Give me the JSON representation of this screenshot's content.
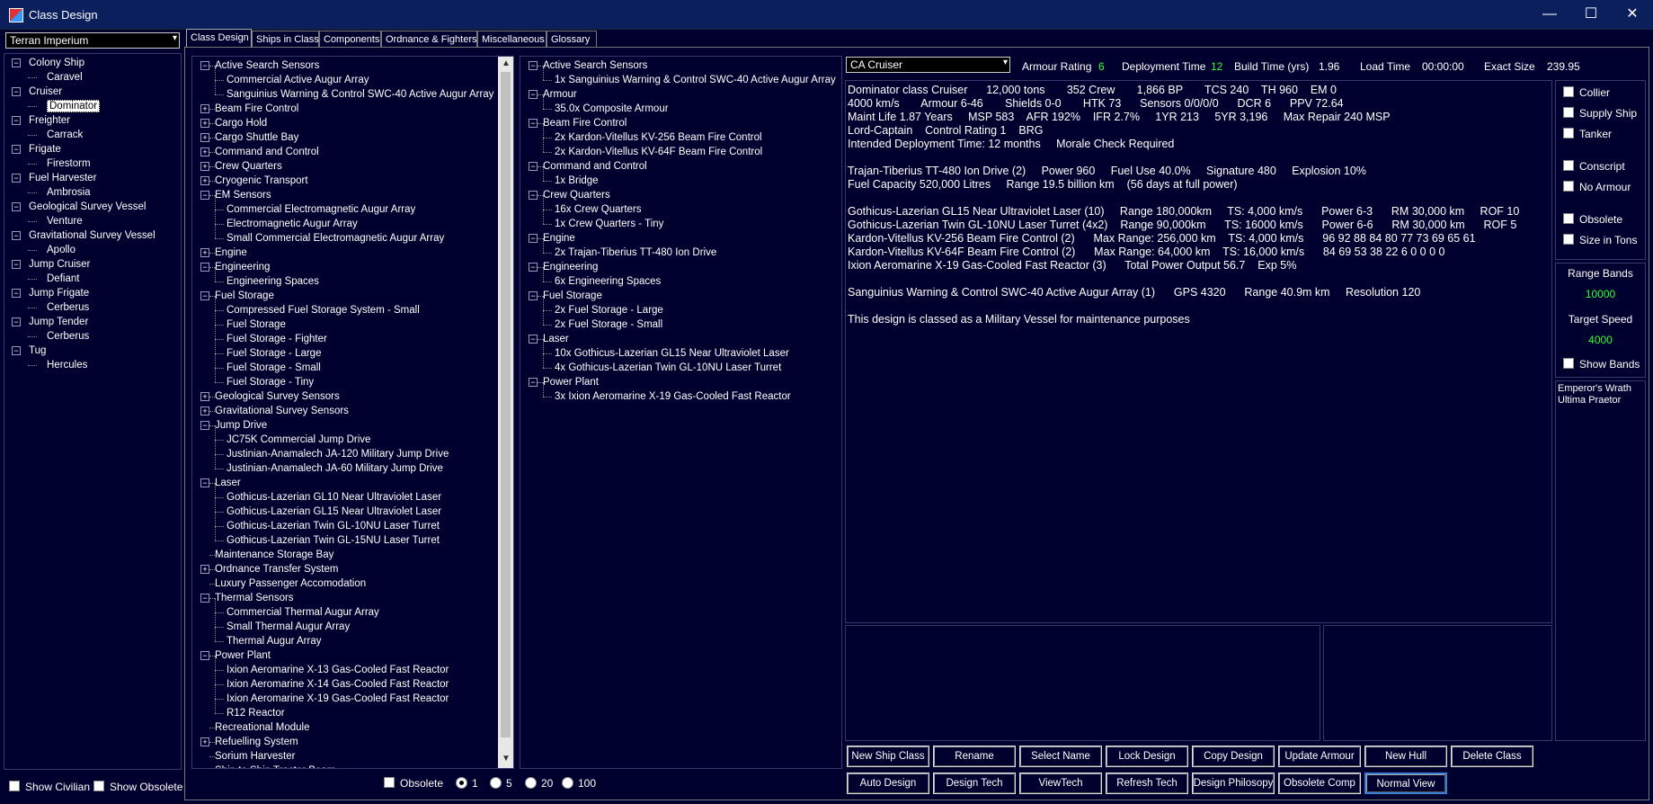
{
  "window": {
    "title": "Class Design",
    "min": "—",
    "max": "☐",
    "close": "✕"
  },
  "left": {
    "race": "Terran Imperium",
    "tree": [
      {
        "label": "Colony Ship",
        "children": [
          "Caravel"
        ]
      },
      {
        "label": "Cruiser",
        "children": [
          "Dominator"
        ]
      },
      {
        "label": "Freighter",
        "children": [
          "Carrack"
        ]
      },
      {
        "label": "Frigate",
        "children": [
          "Firestorm"
        ]
      },
      {
        "label": "Fuel Harvester",
        "children": [
          "Ambrosia"
        ]
      },
      {
        "label": "Geological Survey Vessel",
        "children": [
          "Venture"
        ]
      },
      {
        "label": "Gravitational Survey Vessel",
        "children": [
          "Apollo"
        ]
      },
      {
        "label": "Jump Cruiser",
        "children": [
          "Defiant"
        ]
      },
      {
        "label": "Jump Frigate",
        "children": [
          "Cerberus"
        ]
      },
      {
        "label": "Jump Tender",
        "children": [
          "Cerberus"
        ]
      },
      {
        "label": "Tug",
        "children": [
          "Hercules"
        ]
      }
    ],
    "show_civilian": "Show Civilian",
    "show_obsolete": "Show Obsolete"
  },
  "tabs": [
    "Class Design",
    "Ships in Class",
    "Components",
    "Ordnance & Fighters",
    "Miscellaneous",
    "Glossary"
  ],
  "components": [
    {
      "t": "p",
      "exp": "-",
      "label": "Active Search Sensors"
    },
    {
      "t": "c",
      "label": "Commercial Active Augur Array"
    },
    {
      "t": "c",
      "label": "Sanguinius Warning & Control SWC-40 Active Augur Array"
    },
    {
      "t": "p",
      "exp": "+",
      "label": "Beam Fire Control"
    },
    {
      "t": "p",
      "exp": "+",
      "label": "Cargo Hold"
    },
    {
      "t": "p",
      "exp": "+",
      "label": "Cargo Shuttle Bay"
    },
    {
      "t": "p",
      "exp": "+",
      "label": "Command and Control"
    },
    {
      "t": "p",
      "exp": "+",
      "label": "Crew Quarters"
    },
    {
      "t": "p",
      "exp": "+",
      "label": "Cryogenic Transport"
    },
    {
      "t": "p",
      "exp": "-",
      "label": "EM Sensors"
    },
    {
      "t": "c",
      "label": "Commercial Electromagnetic Augur Array"
    },
    {
      "t": "c",
      "label": "Electromagnetic Augur Array"
    },
    {
      "t": "c",
      "label": "Small Commercial Electromagnetic Augur Array"
    },
    {
      "t": "p",
      "exp": "+",
      "label": "Engine"
    },
    {
      "t": "p",
      "exp": "-",
      "label": "Engineering"
    },
    {
      "t": "c",
      "label": "Engineering Spaces"
    },
    {
      "t": "p",
      "exp": "-",
      "label": "Fuel Storage"
    },
    {
      "t": "c",
      "label": "Compressed Fuel Storage System - Small"
    },
    {
      "t": "c",
      "label": "Fuel Storage"
    },
    {
      "t": "c",
      "label": "Fuel Storage - Fighter"
    },
    {
      "t": "c",
      "label": "Fuel Storage - Large"
    },
    {
      "t": "c",
      "label": "Fuel Storage - Small"
    },
    {
      "t": "c",
      "label": "Fuel Storage - Tiny"
    },
    {
      "t": "p",
      "exp": "+",
      "label": "Geological Survey Sensors"
    },
    {
      "t": "p",
      "exp": "+",
      "label": "Gravitational Survey Sensors"
    },
    {
      "t": "p",
      "exp": "-",
      "label": "Jump Drive"
    },
    {
      "t": "c",
      "label": "JC75K Commercial Jump Drive"
    },
    {
      "t": "c",
      "label": "Justinian-Anamalech JA-120 Military Jump Drive"
    },
    {
      "t": "c",
      "label": "Justinian-Anamalech JA-60 Military Jump Drive"
    },
    {
      "t": "p",
      "exp": "-",
      "label": "Laser"
    },
    {
      "t": "c",
      "label": "Gothicus-Lazerian GL10 Near Ultraviolet Laser"
    },
    {
      "t": "c",
      "label": "Gothicus-Lazerian GL15 Near Ultraviolet Laser"
    },
    {
      "t": "c",
      "label": "Gothicus-Lazerian Twin GL-10NU Laser Turret"
    },
    {
      "t": "c",
      "label": "Gothicus-Lazerian Twin GL-15NU Laser Turret"
    },
    {
      "t": "p",
      "exp": "",
      "label": "Maintenance Storage Bay"
    },
    {
      "t": "p",
      "exp": "+",
      "label": "Ordnance Transfer System"
    },
    {
      "t": "p",
      "exp": "",
      "label": "Luxury Passenger Accomodation"
    },
    {
      "t": "p",
      "exp": "-",
      "label": "Thermal Sensors"
    },
    {
      "t": "c",
      "label": "Commercial Thermal Augur Array"
    },
    {
      "t": "c",
      "label": "Small Thermal Augur Array"
    },
    {
      "t": "c",
      "label": "Thermal Augur Array"
    },
    {
      "t": "p",
      "exp": "-",
      "label": "Power Plant"
    },
    {
      "t": "c",
      "label": "Ixion Aeromarine X-13 Gas-Cooled Fast Reactor"
    },
    {
      "t": "c",
      "label": "Ixion Aeromarine X-14 Gas-Cooled Fast Reactor"
    },
    {
      "t": "c",
      "label": "Ixion Aeromarine X-19 Gas-Cooled Fast Reactor"
    },
    {
      "t": "c",
      "label": "R12 Reactor"
    },
    {
      "t": "p",
      "exp": "",
      "label": "Recreational Module"
    },
    {
      "t": "p",
      "exp": "+",
      "label": "Refuelling System"
    },
    {
      "t": "p",
      "exp": "",
      "label": "Sorium Harvester"
    },
    {
      "t": "p",
      "exp": "",
      "label": "Ship to Ship Tractor Beam"
    }
  ],
  "design": [
    {
      "t": "p",
      "exp": "-",
      "label": "Active Search Sensors"
    },
    {
      "t": "c",
      "label": "1x Sanguinius Warning & Control SWC-40 Active Augur Array"
    },
    {
      "t": "p",
      "exp": "-",
      "label": "Armour"
    },
    {
      "t": "c",
      "label": "35.0x Composite Armour"
    },
    {
      "t": "p",
      "exp": "-",
      "label": "Beam Fire Control"
    },
    {
      "t": "c",
      "label": "2x Kardon-Vitellus KV-256 Beam Fire Control"
    },
    {
      "t": "c",
      "label": "2x Kardon-Vitellus KV-64F Beam Fire Control"
    },
    {
      "t": "p",
      "exp": "-",
      "label": "Command and Control"
    },
    {
      "t": "c",
      "label": "1x Bridge"
    },
    {
      "t": "p",
      "exp": "-",
      "label": "Crew Quarters"
    },
    {
      "t": "c",
      "label": "16x Crew Quarters"
    },
    {
      "t": "c",
      "label": "1x Crew Quarters - Tiny"
    },
    {
      "t": "p",
      "exp": "-",
      "label": "Engine"
    },
    {
      "t": "c",
      "label": "2x Trajan-Tiberius TT-480 Ion Drive"
    },
    {
      "t": "p",
      "exp": "-",
      "label": "Engineering"
    },
    {
      "t": "c",
      "label": "6x Engineering Spaces"
    },
    {
      "t": "p",
      "exp": "-",
      "label": "Fuel Storage"
    },
    {
      "t": "c",
      "label": "2x Fuel Storage - Large"
    },
    {
      "t": "c",
      "label": "2x Fuel Storage - Small"
    },
    {
      "t": "p",
      "exp": "-",
      "label": "Laser"
    },
    {
      "t": "c",
      "label": "10x Gothicus-Lazerian GL15 Near Ultraviolet Laser"
    },
    {
      "t": "c",
      "label": "4x Gothicus-Lazerian Twin GL-10NU Laser Turret"
    },
    {
      "t": "p",
      "exp": "-",
      "label": "Power Plant"
    },
    {
      "t": "c",
      "label": "3x Ixion Aeromarine X-19 Gas-Cooled Fast Reactor"
    }
  ],
  "filters": {
    "obsolete": "Obsolete",
    "radios": [
      "1",
      "5",
      "20",
      "100"
    ],
    "selected": "1"
  },
  "header": {
    "class_name": "CA Cruiser",
    "armour_label": "Armour Rating",
    "armour_value": "6",
    "deploy_label": "Deployment Time",
    "deploy_value": "12",
    "build_label": "Build Time (yrs)",
    "build_value": "1.96",
    "load_label": "Load Time",
    "load_value": "00:00:00",
    "size_label": "Exact Size",
    "size_value": "239.95"
  },
  "summary": [
    "Dominator class Cruiser      12,000 tons       352 Crew       1,866 BP       TCS 240    TH 960    EM 0",
    "4000 km/s       Armour 6-46       Shields 0-0       HTK 73      Sensors 0/0/0/0      DCR 6      PPV 72.64",
    "Maint Life 1.87 Years     MSP 583    AFR 192%    IFR 2.7%     1YR 213     5YR 3,196     Max Repair 240 MSP",
    "Lord-Captain    Control Rating 1    BRG",
    "Intended Deployment Time: 12 months     Morale Check Required",
    "",
    "Trajan-Tiberius TT-480 Ion Drive (2)     Power 960     Fuel Use 40.0%     Signature 480     Explosion 10%",
    "Fuel Capacity 520,000 Litres     Range 19.5 billion km    (56 days at full power)",
    "",
    "Gothicus-Lazerian GL15 Near Ultraviolet Laser (10)     Range 180,000km     TS: 4,000 km/s      Power 6-3      RM 30,000 km     ROF 10",
    "Gothicus-Lazerian Twin GL-10NU Laser Turret (4x2)    Range 90,000km      TS: 16000 km/s      Power 6-6      RM 30,000 km      ROF 5",
    "Kardon-Vitellus KV-256 Beam Fire Control (2)      Max Range: 256,000 km    TS: 4,000 km/s      96 92 88 84 80 77 73 69 65 61",
    "Kardon-Vitellus KV-64F Beam Fire Control (2)      Max Range: 64,000 km    TS: 16,000 km/s      84 69 53 38 22 6 0 0 0 0",
    "Ixion Aeromarine X-19 Gas-Cooled Fast Reactor (3)      Total Power Output 56.7    Exp 5%",
    "",
    "Sanguinius Warning & Control SWC-40 Active Augur Array (1)      GPS 4320      Range 40.9m km     Resolution 120",
    "",
    "This design is classed as a Military Vessel for maintenance purposes"
  ],
  "options": [
    "Collier",
    "Supply Ship",
    "Tanker",
    "Conscript",
    "No Armour",
    "Obsolete",
    "Size in Tons"
  ],
  "range": {
    "bands_label": "Range Bands",
    "bands_value": "10000",
    "speed_label": "Target Speed",
    "speed_value": "4000",
    "show_bands": "Show Bands"
  },
  "commanders": [
    "Emperor's Wrath",
    "Ultima Praetor"
  ],
  "buttons_row1": [
    "New Ship Class",
    "Rename",
    "Select Name",
    "Lock Design",
    "Copy Design",
    "Update Armour",
    "New Hull",
    "Delete Class"
  ],
  "buttons_row2": [
    "Auto Design",
    "Design Tech",
    "ViewTech",
    "Refresh Tech",
    "Design Philosopy",
    "Obsolete Comp",
    "Normal View"
  ]
}
